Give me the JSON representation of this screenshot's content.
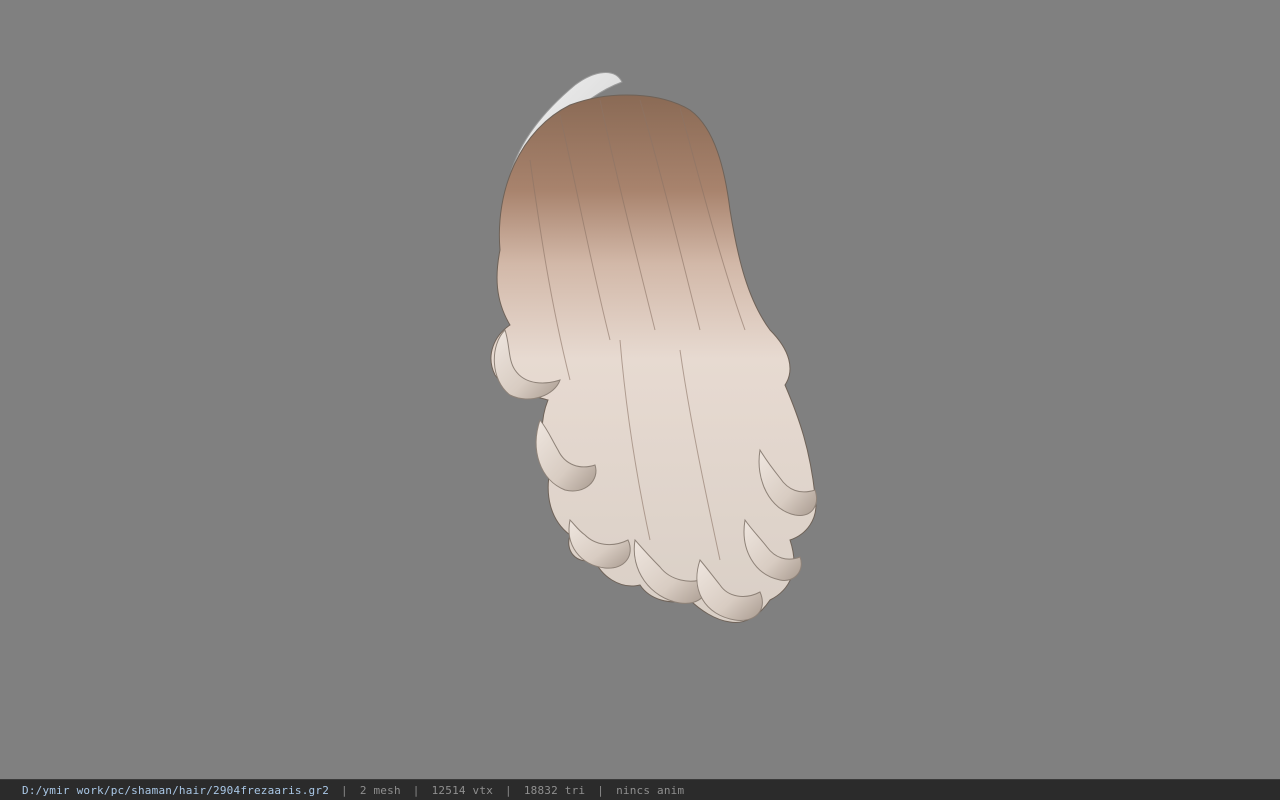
{
  "viewer": {
    "background_color": "#808080",
    "model_icon": "hair-mesh-preview"
  },
  "status_bar": {
    "file_path": "D:/ymir work/pc/shaman/hair/2904frezaaris.gr2",
    "separator": "|",
    "mesh_count": "2 mesh",
    "vertex_count": "12514 vtx",
    "triangle_count": "18832 tri",
    "animation": "nincs anim"
  }
}
